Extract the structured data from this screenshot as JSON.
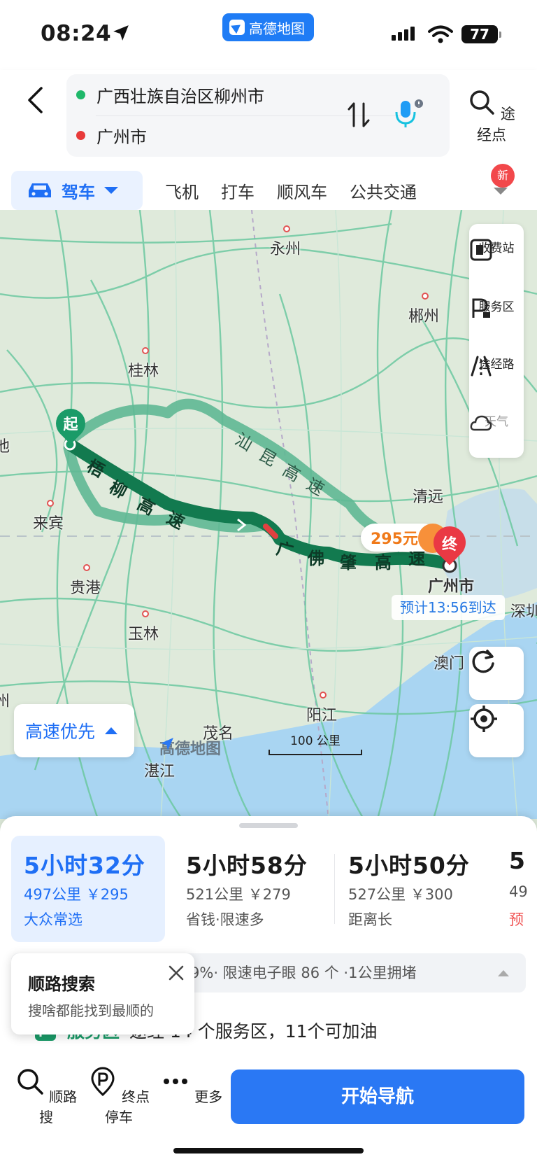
{
  "status_bar": {
    "time": "08:24",
    "app_name": "高德地图",
    "battery": "77"
  },
  "route_input": {
    "origin": "广西壮族自治区柳州市",
    "destination": "广州市",
    "waypoint_label": "途经点"
  },
  "modes": {
    "active": "驾车",
    "items": [
      "飞机",
      "打车",
      "顺风车",
      "公共交通"
    ],
    "new_badge": "新"
  },
  "map": {
    "cities": [
      "永州",
      "郴州",
      "桂林",
      "来宾",
      "清远",
      "广州市",
      "贵港",
      "玉林",
      "澳门",
      "阳江",
      "茂名",
      "深圳",
      "湛江",
      "池",
      "州"
    ],
    "roads": {
      "main1": [
        "梧",
        "柳",
        "高",
        "速"
      ],
      "main2": [
        "广",
        "佛",
        "肇",
        "高",
        "速"
      ],
      "alt": [
        "汕",
        "昆",
        "高",
        "速"
      ]
    },
    "start_label": "起",
    "end_label": "终",
    "toll": "295元",
    "eta": "预计13:56到达",
    "side_tools": [
      "收费站",
      "服务区",
      "途经路",
      "天气"
    ],
    "preference": "高速优先",
    "scale": "100 公里",
    "watermark": "高德地图"
  },
  "routes": [
    {
      "duration": "5小时32分",
      "distance": "497公里 ￥295",
      "tag": "大众常选"
    },
    {
      "duration": "5小时58分",
      "distance": "521公里 ￥279",
      "tag": "省钱·限速多"
    },
    {
      "duration": "5小时50分",
      "distance": "527公里 ￥300",
      "tag": "距离长"
    },
    {
      "duration": "5",
      "distance": "49",
      "tag": "预"
    }
  ],
  "info_bar": "9%· 限速电子眼 86 个 ·1公里拥堵",
  "service": {
    "label": "服务区",
    "text": "途经 14 个服务区，11个可加油"
  },
  "tooltip": {
    "title": "顺路搜索",
    "subtitle": "搜啥都能找到最顺的"
  },
  "bottom_nav": {
    "items": [
      "顺路搜",
      "终点停车",
      "更多"
    ],
    "start_button": "开始导航"
  },
  "colors": {
    "accent": "#1f6ff5",
    "route_main": "#127a4f",
    "route_alt": "#5fb894",
    "toll": "#f07a1a",
    "end_pin": "#ea3944",
    "start_pin": "#1a9b68"
  }
}
